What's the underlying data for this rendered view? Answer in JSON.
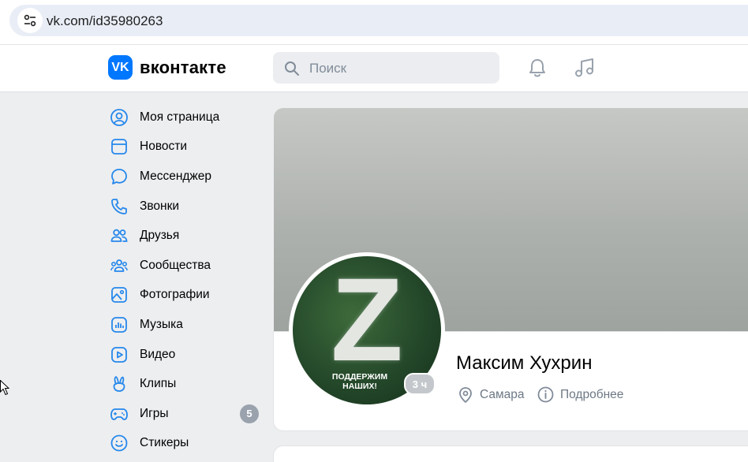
{
  "browser": {
    "url": "vk.com/id35980263"
  },
  "header": {
    "logo_text": "вконтакте",
    "logo_badge": "VK",
    "search_placeholder": "Поиск"
  },
  "sidebar": {
    "items": [
      {
        "label": "Моя страница",
        "icon": "user-circle-icon"
      },
      {
        "label": "Новости",
        "icon": "news-icon"
      },
      {
        "label": "Мессенджер",
        "icon": "message-bubble-icon"
      },
      {
        "label": "Звонки",
        "icon": "phone-icon"
      },
      {
        "label": "Друзья",
        "icon": "friends-icon"
      },
      {
        "label": "Сообщества",
        "icon": "communities-icon"
      },
      {
        "label": "Фотографии",
        "icon": "photo-icon"
      },
      {
        "label": "Музыка",
        "icon": "music-bars-icon"
      },
      {
        "label": "Видео",
        "icon": "video-icon"
      },
      {
        "label": "Клипы",
        "icon": "clips-icon"
      },
      {
        "label": "Игры",
        "icon": "gamepad-icon",
        "badge": "5"
      },
      {
        "label": "Стикеры",
        "icon": "smile-icon"
      }
    ]
  },
  "profile": {
    "name": "Максим Хухрин",
    "city": "Самара",
    "details_link": "Подробнее",
    "status_time": "3 ч",
    "avatar_letter": "Z",
    "avatar_caption_line1": "ПОДДЕРЖИМ",
    "avatar_caption_line2": "НАШИХ!"
  },
  "colors": {
    "accent": "#0077ff",
    "icon_blue": "#2688eb",
    "page_bg": "#edeef0",
    "muted_text": "#6d7885"
  }
}
